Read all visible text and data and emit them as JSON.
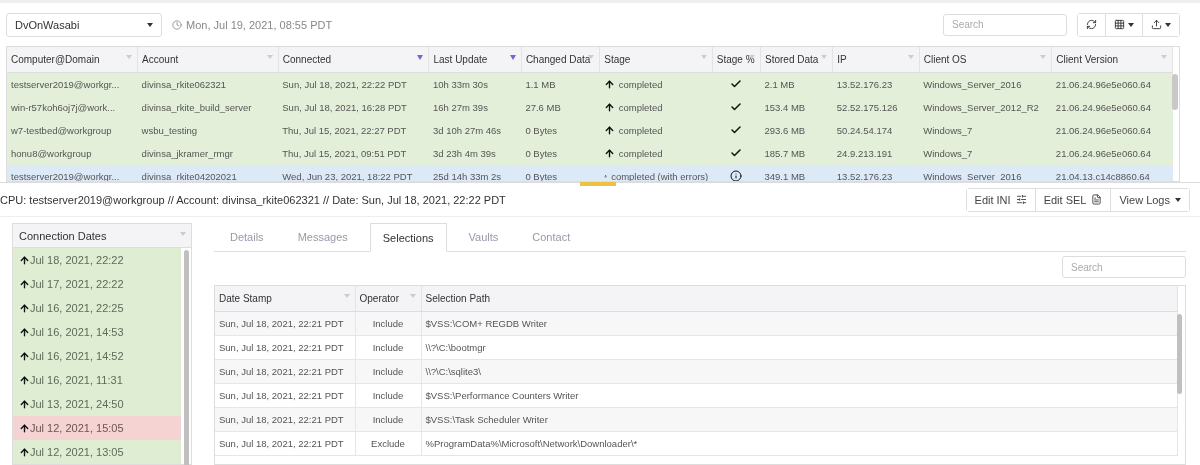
{
  "toolbar": {
    "profile": "DvOnWasabi",
    "timestamp": "Mon, Jul 19, 2021, 08:55 PDT",
    "search": {
      "placeholder": "Search"
    }
  },
  "clients": {
    "columns": [
      {
        "label": "Computer@Domain",
        "sorted": false
      },
      {
        "label": "Account",
        "sorted": false
      },
      {
        "label": "Connected",
        "sorted": true
      },
      {
        "label": "Last Update",
        "sorted": true
      },
      {
        "label": "Changed Data",
        "sorted": false
      },
      {
        "label": "Stage",
        "sorted": false
      },
      {
        "label": "Stage %",
        "sorted": false
      },
      {
        "label": "Stored Data",
        "sorted": false
      },
      {
        "label": "IP",
        "sorted": false
      },
      {
        "label": "Client OS",
        "sorted": false
      },
      {
        "label": "Client Version",
        "sorted": false
      }
    ],
    "rows": [
      {
        "selected": false,
        "kind": "check",
        "computer": "testserver2019@workgr...",
        "account": "divinsa_rkite062321",
        "connected": "Sun, Jul 18, 2021, 22:22 PDT",
        "last_update": "10h 33m 30s",
        "changed": "1.1 MB",
        "stage": "completed",
        "stored": "2.1 MB",
        "ip": "13.52.176.23",
        "os": "Windows_Server_2016",
        "version": "21.06.24.96e5e060.64"
      },
      {
        "selected": false,
        "kind": "check",
        "computer": "win-r57koh6oj7j@work...",
        "account": "divinsa_rkite_build_server",
        "connected": "Sun, Jul 18, 2021, 16:28 PDT",
        "last_update": "16h 27m 39s",
        "changed": "27.6 MB",
        "stage": "completed",
        "stored": "153.4 MB",
        "ip": "52.52.175.126",
        "os": "Windows_Server_2012_R2",
        "version": "21.06.24.96e5e060.64"
      },
      {
        "selected": false,
        "kind": "check",
        "computer": "w7-testbed@workgroup",
        "account": "wsbu_testing",
        "connected": "Thu, Jul 15, 2021, 22:27 PDT",
        "last_update": "3d 10h 27m 46s",
        "changed": "0 Bytes",
        "stage": "completed",
        "stored": "293.6 MB",
        "ip": "50.24.54.174",
        "os": "Windows_7",
        "version": "21.06.24.96e5e060.64"
      },
      {
        "selected": false,
        "kind": "check",
        "computer": "honu8@workgroup",
        "account": "divinsa_jkramer_rmgr",
        "connected": "Thu, Jul 15, 2021, 09:51 PDT",
        "last_update": "3d 23h 4m 39s",
        "changed": "0 Bytes",
        "stage": "completed",
        "stored": "185.7 MB",
        "ip": "24.9.213.191",
        "os": "Windows_7",
        "version": "21.06.24.96e5e060.64"
      },
      {
        "selected": true,
        "kind": "info",
        "computer": "testserver2019@workgr...",
        "account": "divinsa_rkite04202021",
        "connected": "Wed, Jun 23, 2021, 18:22 PDT",
        "last_update": "25d 14h 33m 2s",
        "changed": "0 Bytes",
        "stage": "completed (with errors)",
        "stored": "349.1 MB",
        "ip": "13.52.176.23",
        "os": "Windows_Server_2016",
        "version": "21.04.13.c14c8860.64"
      }
    ]
  },
  "detail": {
    "caption": "CPU: testserver2019@workgroup // Account: divinsa_rkite062321 // Date: Sun, Jul 18, 2021, 22:22 PDT",
    "buttons": [
      {
        "label": "Edit INI",
        "kind": "sliders"
      },
      {
        "label": "Edit SEL",
        "kind": "file"
      },
      {
        "label": "View Logs",
        "kind": "dropdown"
      }
    ]
  },
  "connection_dates": {
    "heading": "Connection Dates",
    "items": [
      {
        "label": "Jul 18, 2021, 22:22",
        "error": false
      },
      {
        "label": "Jul 17, 2021, 22:22",
        "error": false
      },
      {
        "label": "Jul 16, 2021, 22:25",
        "error": false
      },
      {
        "label": "Jul 16, 2021, 14:53",
        "error": false
      },
      {
        "label": "Jul 16, 2021, 14:52",
        "error": false
      },
      {
        "label": "Jul 16, 2021, 11:31",
        "error": false
      },
      {
        "label": "Jul 13, 2021, 24:50",
        "error": false
      },
      {
        "label": "Jul 12, 2021, 15:05",
        "error": true
      },
      {
        "label": "Jul 12, 2021, 13:05",
        "error": false
      }
    ]
  },
  "tabs": [
    {
      "label": "Details",
      "selected": false
    },
    {
      "label": "Messages",
      "selected": false
    },
    {
      "label": "Selections",
      "selected": true
    },
    {
      "label": "Vaults",
      "selected": false
    },
    {
      "label": "Contact",
      "selected": false
    }
  ],
  "selections": {
    "search": {
      "placeholder": "Search"
    },
    "columns": [
      "Date Stamp",
      "Operator",
      "Selection Path"
    ],
    "rows": [
      [
        "Sun, Jul 18, 2021, 22:21 PDT",
        "Include",
        "$VSS:\\COM+ REGDB Writer"
      ],
      [
        "Sun, Jul 18, 2021, 22:21 PDT",
        "Include",
        "\\\\?\\C:\\bootmgr"
      ],
      [
        "Sun, Jul 18, 2021, 22:21 PDT",
        "Include",
        "\\\\?\\C:\\sqlite3\\"
      ],
      [
        "Sun, Jul 18, 2021, 22:21 PDT",
        "Include",
        "$VSS:\\Performance Counters Writer"
      ],
      [
        "Sun, Jul 18, 2021, 22:21 PDT",
        "Include",
        "$VSS:\\Task Scheduler Writer"
      ],
      [
        "Sun, Jul 18, 2021, 22:21 PDT",
        "Exclude",
        "%ProgramData%\\Microsoft\\Network\\Downloader\\*"
      ]
    ]
  }
}
